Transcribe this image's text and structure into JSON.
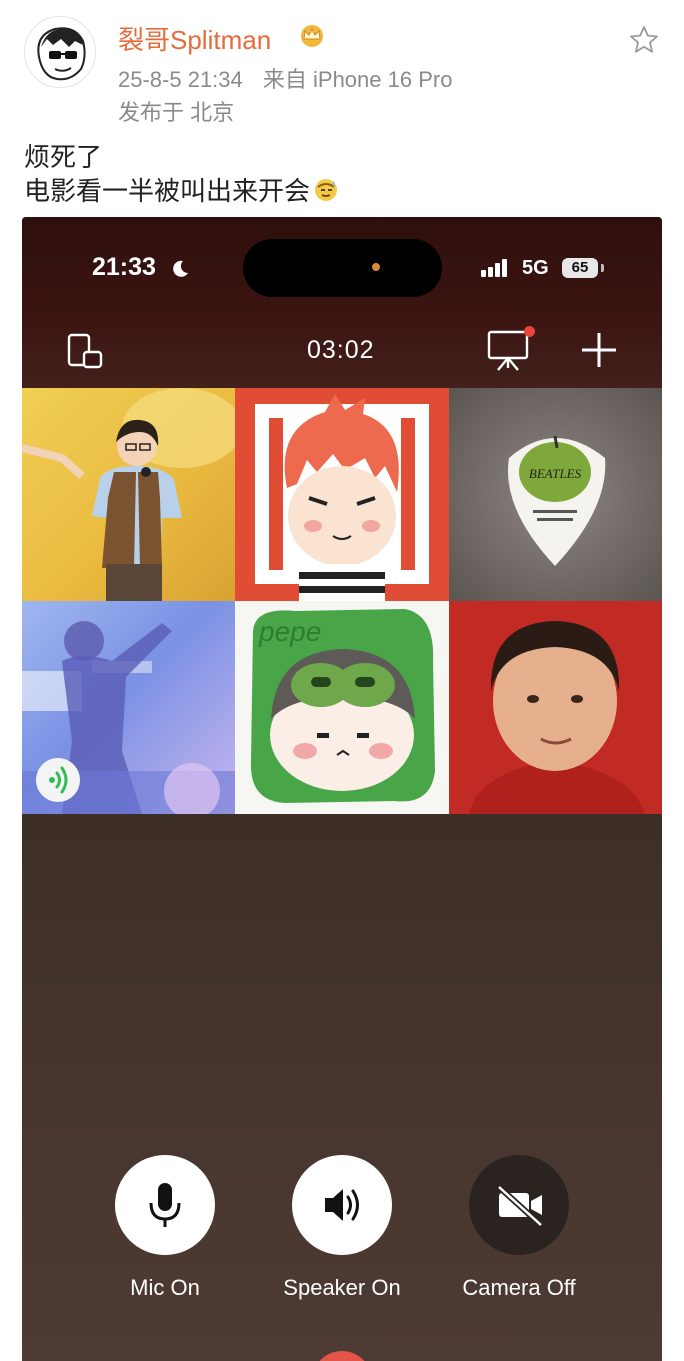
{
  "post": {
    "username": "裂哥Splitman",
    "date": "25-8-5 21:34",
    "source": "来自 iPhone 16 Pro",
    "location": "发布于 北京",
    "text_line1": "烦死了",
    "text_line2": "电影看一半被叫出来开会"
  },
  "phone": {
    "status_time": "21:33",
    "network": "5G",
    "battery": "65",
    "call_duration": "03:02"
  },
  "controls": [
    {
      "label": "Mic On",
      "state": "on",
      "icon": "microphone-icon"
    },
    {
      "label": "Speaker On",
      "state": "on",
      "icon": "speaker-icon"
    },
    {
      "label": "Camera Off",
      "state": "off",
      "icon": "camera-off-icon"
    }
  ],
  "colors": {
    "username": "#e8693a",
    "meta": "#8a8a8a",
    "call_background": "#3d2e28",
    "hangup": "#e25548"
  }
}
